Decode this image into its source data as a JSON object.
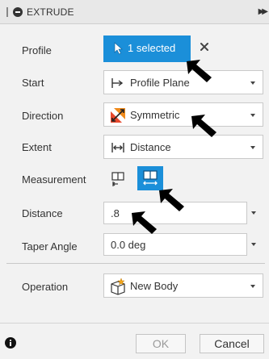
{
  "dialog": {
    "title": "EXTRUDE"
  },
  "profile": {
    "label": "Profile",
    "selection_text": "1 selected"
  },
  "start": {
    "label": "Start",
    "value": "Profile Plane",
    "icon": "profile-plane-icon"
  },
  "direction": {
    "label": "Direction",
    "value": "Symmetric",
    "icon": "symmetric-icon"
  },
  "extent": {
    "label": "Extent",
    "value": "Distance",
    "icon": "distance-icon"
  },
  "measurement": {
    "label": "Measurement",
    "options": [
      "half-length-icon",
      "whole-length-icon"
    ],
    "selected_index": 1
  },
  "distance": {
    "label": "Distance",
    "value": ".8"
  },
  "taper_angle": {
    "label": "Taper Angle",
    "value": "0.0 deg"
  },
  "operation": {
    "label": "Operation",
    "value": "New Body",
    "icon": "new-body-icon"
  },
  "footer": {
    "ok_label": "OK",
    "cancel_label": "Cancel"
  },
  "colors": {
    "accent": "#1b8fd9",
    "panel_bg": "#f2f2f2",
    "header_bg": "#e8e8e8"
  }
}
